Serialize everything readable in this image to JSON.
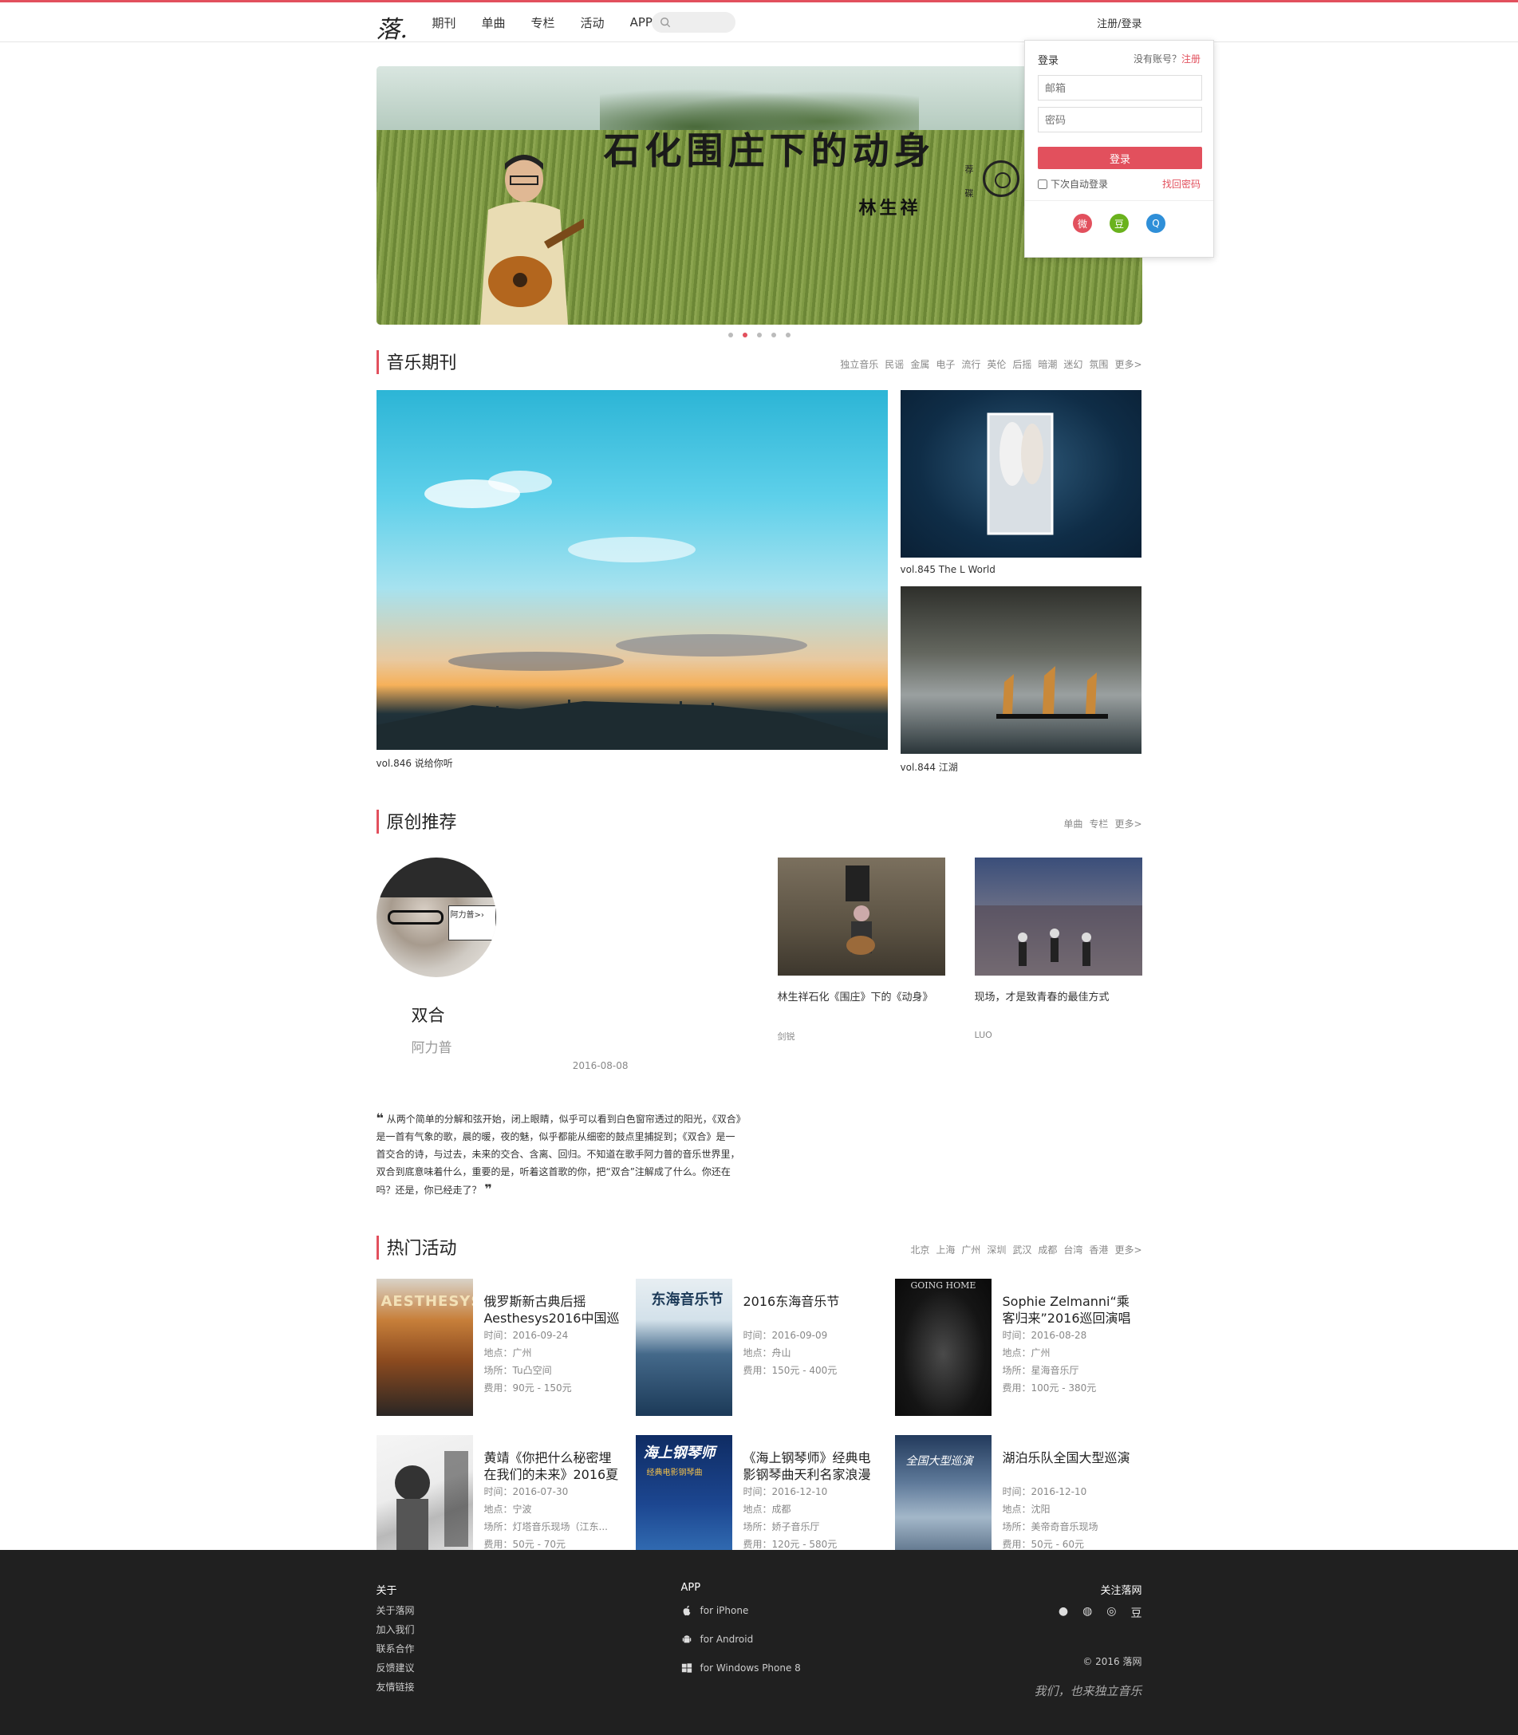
{
  "nav": {
    "logo": "落.",
    "links": [
      "期刊",
      "单曲",
      "专栏",
      "活动",
      "APP"
    ],
    "search_placeholder": "",
    "register_login": "注册/登录"
  },
  "login": {
    "title": "登录",
    "no_account": "没有账号？",
    "register": "注册",
    "email_placeholder": "邮箱",
    "password_placeholder": "密码",
    "submit": "登录",
    "auto_login": "下次自动登录",
    "forgot": "找回密码",
    "social_icons": [
      "weibo-icon",
      "douban-icon",
      "qq-icon"
    ],
    "social_colors": [
      "#e2505d",
      "#6ab21d",
      "#2f8fd8"
    ]
  },
  "banner": {
    "title": "石化围庄下的动身",
    "artist": "林生祥",
    "side_text": "荐碟",
    "dots": [
      false,
      true,
      false,
      false,
      false
    ]
  },
  "music": {
    "title": "音乐期刊",
    "tags": [
      "独立音乐",
      "民谣",
      "金属",
      "电子",
      "流行",
      "英伦",
      "后摇",
      "暗潮",
      "迷幻",
      "氛围",
      "更多>"
    ],
    "big_caption": "vol.846 说给你听",
    "small": [
      {
        "caption": "vol.845 The L World"
      },
      {
        "caption": "vol.844 江湖"
      }
    ]
  },
  "original": {
    "title": "原创推荐",
    "tags": [
      "单曲",
      "专栏",
      "更多>"
    ],
    "song": "双合",
    "artist": "阿力普",
    "date": "2016-08-08",
    "quote": "从两个简单的分解和弦开始，闭上眼睛，似乎可以看到白色窗帘透过的阳光，《双合》是一首有气象的歌，晨的暖，夜的魅，似乎都能从细密的鼓点里捕捉到；《双合》是一首交合的诗，与过去，未来的交合、含离、回归。不知道在歌手阿力普的音乐世界里，双合到底意味着什么，重要的是，听着这首歌的你，把“双合”注解成了什么。你还在吗？还是，你已经走了？",
    "cards": [
      {
        "title": "林生祥石化《围庄》下的《动身》",
        "author": "剑锐"
      },
      {
        "title": "现场，才是致青春的最佳方式",
        "author": "LUO"
      }
    ]
  },
  "events": {
    "title": "热门活动",
    "tags": [
      "北京",
      "上海",
      "广州",
      "深圳",
      "武汉",
      "成都",
      "台湾",
      "香港",
      "更多>"
    ],
    "items": [
      {
        "title": "俄罗斯新古典后摇Aesthesys2016中国巡",
        "time": "时间：2016-09-24",
        "place": "地点：广州",
        "venue": "场所：Tu凸空间",
        "fee": "费用：90元 - 150元"
      },
      {
        "title": "2016东海音乐节",
        "time": "时间：2016-09-09",
        "place": "地点：舟山",
        "venue": "",
        "fee": "费用：150元 - 400元"
      },
      {
        "title": "Sophie Zelmanni“乘客归来”2016巡回演唱",
        "time": "时间：2016-08-28",
        "place": "地点：广州",
        "venue": "场所：星海音乐厅",
        "fee": "费用：100元 - 380元"
      },
      {
        "title": "黄靖《你把什么秘密埋在我们的未来》2016夏",
        "time": "时间：2016-07-30",
        "place": "地点：宁波",
        "venue": "场所：灯塔音乐现场（江东...",
        "fee": "费用：50元 - 70元"
      },
      {
        "title": "《海上钢琴师》经典电影钢琴曲天利名家浪漫",
        "time": "时间：2016-12-10",
        "place": "地点：成都",
        "venue": "场所：娇子音乐厅",
        "fee": "费用：120元 - 580元"
      },
      {
        "title": "湖泊乐队全国大型巡演",
        "time": "时间：2016-12-10",
        "place": "地点：沈阳",
        "venue": "场所：美帝奇音乐现场",
        "fee": "费用：50元 - 60元"
      }
    ]
  },
  "footer": {
    "about_title": "关于",
    "about_links": [
      "关于落网",
      "加入我们",
      "联系合作",
      "反馈建议",
      "友情链接"
    ],
    "app_title": "APP",
    "app_links": [
      "for iPhone",
      "for Android",
      "for Windows Phone 8"
    ],
    "follow_title": "关注落网",
    "follow_icons": [
      "qq-icon",
      "wechat-icon",
      "weibo-icon",
      "douban-icon"
    ],
    "copyright": "© 2016 落网",
    "slogan": "我们，也来独立音乐"
  },
  "colors": {
    "accent": "#e2505d",
    "footer_bg": "#202020"
  }
}
